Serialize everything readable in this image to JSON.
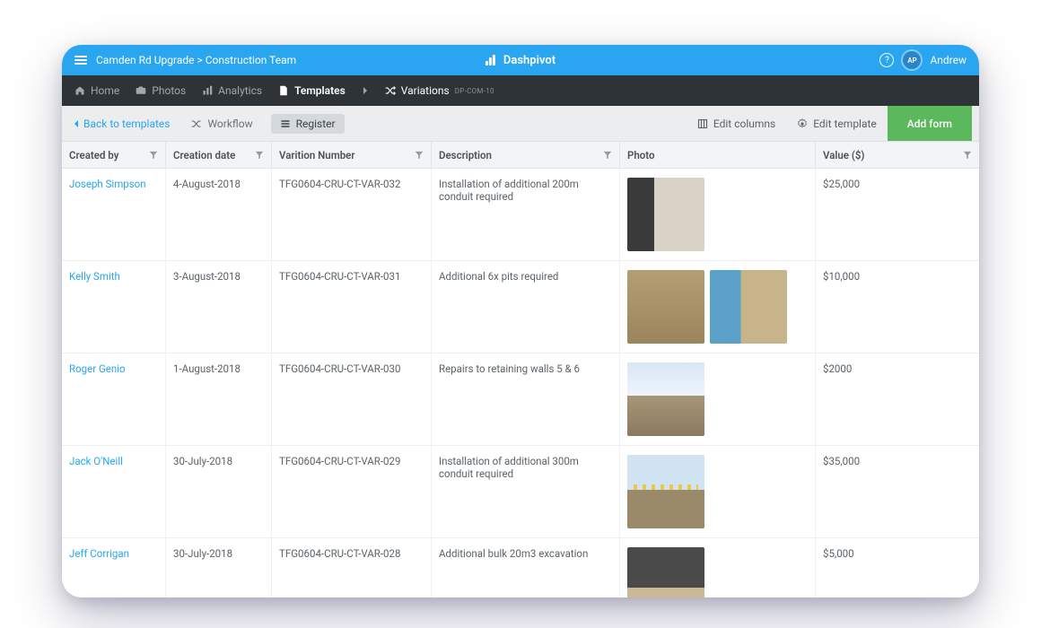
{
  "titlebar": {
    "breadcrumb": "Camden Rd Upgrade > Construction Team",
    "brand": "Dashpivot",
    "avatar_initials": "AP",
    "username": "Andrew"
  },
  "nav": {
    "home": "Home",
    "photos": "Photos",
    "analytics": "Analytics",
    "templates": "Templates",
    "variations": "Variations",
    "variations_code": "DP-COM-10"
  },
  "toolbar": {
    "back": "Back to templates",
    "workflow": "Workflow",
    "register": "Register",
    "edit_columns": "Edit columns",
    "edit_template": "Edit template",
    "add_form": "Add form"
  },
  "columns": {
    "created_by": "Created by",
    "creation_date": "Creation date",
    "variation_number": "Varition Number",
    "description": "Description",
    "photo": "Photo",
    "value": "Value ($)"
  },
  "rows": [
    {
      "created_by": "Joseph Simpson",
      "creation_date": "4-August-2018",
      "variation_number": "TFG0604-CRU-CT-VAR-032",
      "description": "Installation of additional 200m conduit required",
      "value": "$25,000",
      "photos": [
        "interior"
      ]
    },
    {
      "created_by": "Kelly Smith",
      "creation_date": "3-August-2018",
      "variation_number": "TFG0604-CRU-CT-VAR-031",
      "description": "Additional 6x pits required",
      "value": "$10,000",
      "photos": [
        "dirt",
        "trench"
      ]
    },
    {
      "created_by": "Roger Genio",
      "creation_date": "1-August-2018",
      "variation_number": "TFG0604-CRU-CT-VAR-030",
      "description": "Repairs to retaining walls 5 & 6",
      "value": "$2000",
      "photos": [
        "sky"
      ]
    },
    {
      "created_by": "Jack O'Neill",
      "creation_date": "30-July-2018",
      "variation_number": "TFG0604-CRU-CT-VAR-029",
      "description": "Installation of additional 300m conduit required",
      "value": "$35,000",
      "photos": [
        "fence"
      ]
    },
    {
      "created_by": "Jeff Corrigan",
      "creation_date": "30-July-2018",
      "variation_number": "TFG0604-CRU-CT-VAR-028",
      "description": "Additional bulk 20m3 excavation",
      "value": "$5,000",
      "photos": [
        "excavator"
      ]
    }
  ]
}
